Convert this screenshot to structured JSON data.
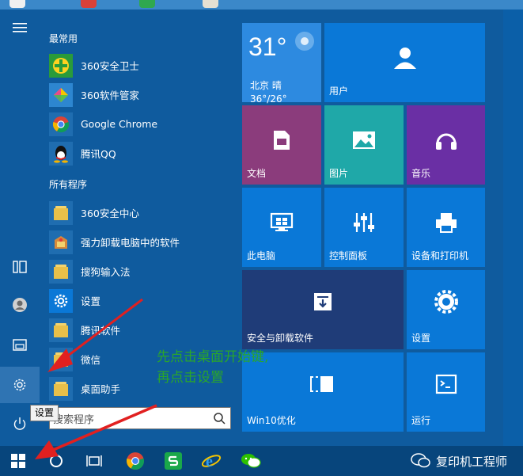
{
  "colors": {
    "accent": "#0f5b9e",
    "tile_blue": "#0a78d7",
    "tile_purple_docs": "#8b3c7c",
    "tile_teal_pictures": "#1fa8a8",
    "tile_purple_music": "#6a2fa4",
    "tile_dark_navy": "#1f3c78",
    "annotation_green": "#2aa62a",
    "arrow_red": "#e12020"
  },
  "rail": {
    "menu_icon": "hamburger-icon",
    "tooltip": "设置"
  },
  "applist": {
    "most_used_header": "最常用",
    "most_used": [
      {
        "label": "360安全卫士",
        "icon": "360-safeguard-icon"
      },
      {
        "label": "360软件管家",
        "icon": "360-software-manager-icon"
      },
      {
        "label": "Google Chrome",
        "icon": "chrome-icon"
      },
      {
        "label": "腾讯QQ",
        "icon": "qq-icon"
      }
    ],
    "all_programs_header": "所有程序",
    "all_programs": [
      {
        "label": "360安全中心",
        "icon": "folder-icon"
      },
      {
        "label": "强力卸载电脑中的软件",
        "icon": "uninstaller-icon"
      },
      {
        "label": "搜狗输入法",
        "icon": "folder-icon"
      },
      {
        "label": "设置",
        "icon": "gear-icon"
      },
      {
        "label": "腾讯软件",
        "icon": "folder-icon"
      },
      {
        "label": "微信",
        "icon": "folder-icon"
      },
      {
        "label": "桌面助手",
        "icon": "folder-icon"
      }
    ]
  },
  "search": {
    "placeholder_visible": "搜索程序"
  },
  "tiles": {
    "weather": {
      "temp": "31°",
      "city": "北京 晴",
      "range": "36°/26°"
    },
    "user": "用户",
    "documents": "文档",
    "pictures": "图片",
    "music": "音乐",
    "this_pc": "此电脑",
    "control_panel": "控制面板",
    "devices_printers": "设备和打印机",
    "security_uninstall": "安全与卸载软件",
    "settings": "设置",
    "win10_optimize": "Win10优化",
    "run": "运行"
  },
  "annotation": {
    "line1": "先点击桌面开始键,",
    "line2": "再点击设置"
  },
  "taskbar": {
    "watermark": "复印机工程师"
  }
}
